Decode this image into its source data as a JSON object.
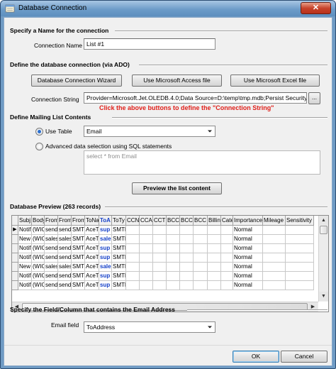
{
  "window": {
    "title": "Database Connection",
    "close_label": "✕"
  },
  "sections": {
    "name": "Specify a Name for the connection",
    "connection": "Define the database connection (via ADO)",
    "contents": "Define Mailing List Contents",
    "preview": "Database Preview (263 records)",
    "email_field": "Specify the Field/Column that contains the Email Address"
  },
  "name_form": {
    "label": "Connection Name",
    "value": "List #1"
  },
  "connection_form": {
    "wizard_button": "Database Connection Wizard",
    "access_button": "Use Microsoft Access file",
    "excel_button": "Use Microsoft Excel file",
    "string_label": "Connection String",
    "string_value": "Provider=Microsoft.Jet.OLEDB.4.0;Data Source=D:\\temp\\tmp.mdb;Persist Security Inf",
    "browse_button": "...",
    "hint": "Click the above buttons to define the \"Connection String\""
  },
  "contents_form": {
    "use_table_label": "Use Table",
    "table_value": "Email",
    "advanced_label": "Advanced data selection using SQL statements",
    "sql_value": "select * from Email",
    "preview_button": "Preview the list content"
  },
  "grid": {
    "columns": [
      "Subj",
      "Body",
      "From",
      "From",
      "From",
      "ToNa",
      "ToA",
      "ToTy",
      "CCNa",
      "CCA",
      "CCT",
      "BCC",
      "BCC",
      "BCC",
      "Billing",
      "Cate",
      "Importance",
      "Mileage",
      "Sensitivity"
    ],
    "rows": [
      [
        "Notif",
        "(WIC",
        "send",
        "send",
        "SMTF",
        "AceT",
        "sup",
        "SMTF",
        "",
        "",
        "",
        "",
        "",
        "",
        "",
        "",
        "Normal",
        "",
        ""
      ],
      [
        "New",
        "(WIC",
        "sales",
        "sales",
        "SMTF",
        "AceT",
        "sale",
        "SMTF",
        "",
        "",
        "",
        "",
        "",
        "",
        "",
        "",
        "Normal",
        "",
        ""
      ],
      [
        "Notif",
        "(WIC",
        "send",
        "send",
        "SMTF",
        "AceT",
        "sup",
        "SMTF",
        "",
        "",
        "",
        "",
        "",
        "",
        "",
        "",
        "Normal",
        "",
        ""
      ],
      [
        "Notif",
        "(WIC",
        "send",
        "send",
        "SMTF",
        "AceT",
        "sup",
        "SMTF",
        "",
        "",
        "",
        "",
        "",
        "",
        "",
        "",
        "Normal",
        "",
        ""
      ],
      [
        "New",
        "(WIC",
        "sales",
        "sales",
        "SMTF",
        "AceT",
        "sale",
        "SMTF",
        "",
        "",
        "",
        "",
        "",
        "",
        "",
        "",
        "Normal",
        "",
        ""
      ],
      [
        "Notif",
        "(WIC",
        "send",
        "send",
        "SMTF",
        "AceT",
        "sup",
        "SMTF",
        "",
        "",
        "",
        "",
        "",
        "",
        "",
        "",
        "Normal",
        "",
        ""
      ],
      [
        "Notif",
        "(WIC",
        "send",
        "send",
        "SMTF",
        "AceT",
        "sup",
        "SMTF",
        "",
        "",
        "",
        "",
        "",
        "",
        "",
        "",
        "Normal",
        "",
        ""
      ]
    ],
    "current_row_marker": "▶"
  },
  "email_form": {
    "label": "Email field",
    "value": "ToAddress"
  },
  "footer": {
    "ok": "OK",
    "cancel": "Cancel"
  },
  "icons": {
    "title": "database-icon",
    "dropdown": "chevron-down-icon"
  },
  "colors": {
    "hint": "#e0201a",
    "to_address_col": "#1540c8"
  }
}
